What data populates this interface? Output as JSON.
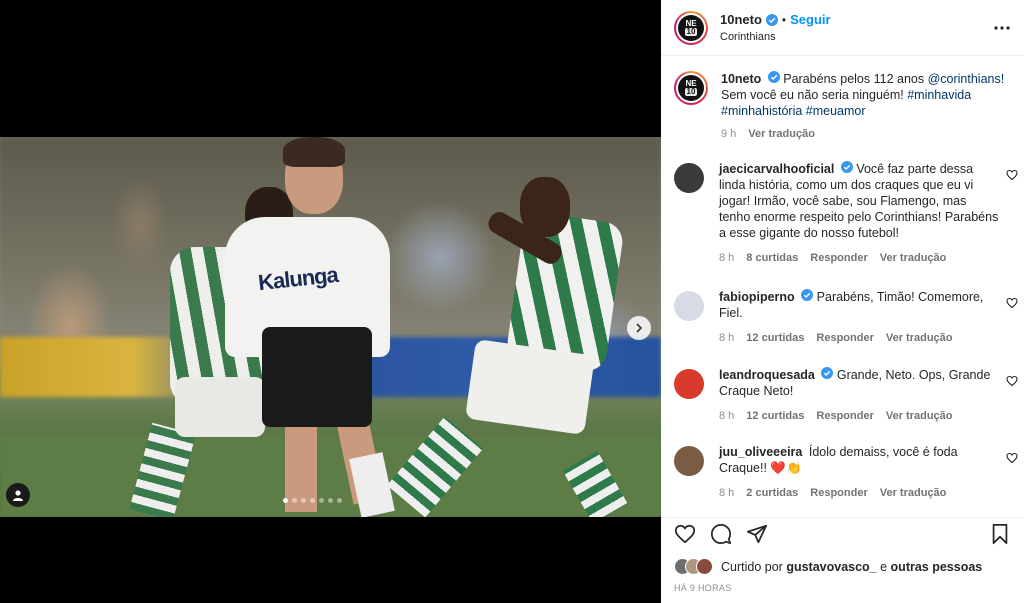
{
  "post": {
    "username": "10neto",
    "follow_label": "Seguir",
    "separator": "•",
    "location": "Corinthians",
    "shirt_sponsor": "Kalunga",
    "carousel_dots": 7
  },
  "caption": {
    "username": "10neto",
    "text": "Parabéns pelos 112 anos ",
    "mention": "@corinthians!",
    "text2": " Sem você eu não seria ninguém! ",
    "tags": "#minhavida #minhahistória #meuamor",
    "time": "9 h",
    "translate": "Ver tradução"
  },
  "comments": [
    {
      "username": "jaecicarvalhooficial",
      "verified": true,
      "text": "Você faz parte dessa linda história, como um dos craques que eu vi jogar! Irmão, você sabe, sou Flamengo, mas tenho enorme respeito pelo Corinthians! Parabéns a esse gigante do nosso futebol!",
      "time": "8 h",
      "likes": "8 curtidas",
      "reply": "Responder",
      "translate": "Ver tradução",
      "avatar_color": "#3a3a3a"
    },
    {
      "username": "fabiopiperno",
      "verified": true,
      "text": "Parabéns, Timão! Comemore, Fiel.",
      "time": "8 h",
      "likes": "12 curtidas",
      "reply": "Responder",
      "translate": "Ver tradução",
      "avatar_color": "#d7dbe3"
    },
    {
      "username": "leandroquesada",
      "verified": true,
      "text": "Grande, Neto. Ops, Grande Craque Neto!",
      "time": "8 h",
      "likes": "12 curtidas",
      "reply": "Responder",
      "translate": "Ver tradução",
      "avatar_color": "#d93a2b"
    },
    {
      "username": "juu_oliveeeira",
      "verified": false,
      "text": "Ídolo demaiss, você é foda Craque!! ",
      "emoji": "❤️👏",
      "time": "8 h",
      "likes": "2 curtidas",
      "reply": "Responder",
      "translate": "Ver tradução",
      "avatar_color": "#7a5b44"
    }
  ],
  "likes": {
    "prefix": "Curtido por ",
    "user": "gustavovasco_",
    "mid": " e ",
    "others": "outras pessoas"
  },
  "timestamp": "HÁ 9 HORAS",
  "colors": {
    "accent": "#0095f6",
    "verified": "#3897f0",
    "heart_red": "#ed4956"
  }
}
